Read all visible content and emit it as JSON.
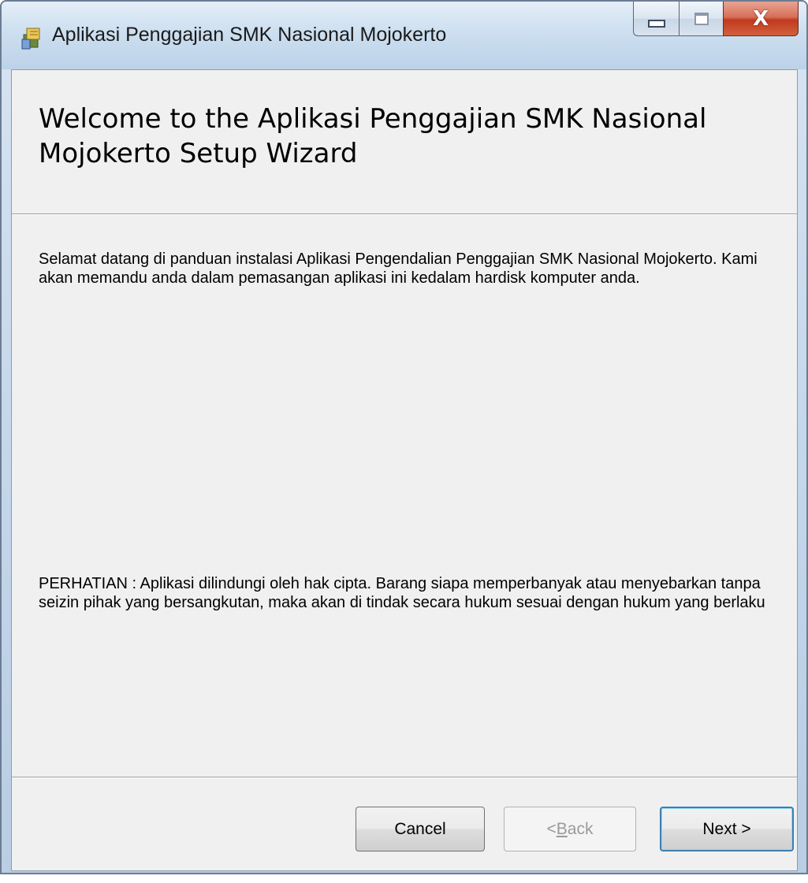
{
  "window": {
    "title": "Aplikasi Penggajian SMK Nasional Mojokerto",
    "icon": "installer-package-icon"
  },
  "caption_buttons": {
    "minimize_icon": "minimize-icon",
    "maximize_icon": "maximize-icon",
    "close_label": "X"
  },
  "header": {
    "title": "Welcome to the Aplikasi Penggajian SMK Nasional Mojokerto Setup Wizard"
  },
  "body": {
    "intro": "Selamat datang di panduan instalasi Aplikasi Pengendalian Penggajian SMK Nasional Mojokerto. Kami akan memandu anda dalam pemasangan aplikasi ini kedalam hardisk komputer anda.",
    "notice": "PERHATIAN : Aplikasi dilindungi oleh hak cipta. Barang siapa memperbanyak atau menyebarkan tanpa seizin pihak yang bersangkutan, maka akan di tindak secara hukum sesuai dengan hukum yang berlaku"
  },
  "buttons": {
    "cancel": "Cancel",
    "back_prefix": "< ",
    "back_accel": "B",
    "back_rest": "ack",
    "next": "Next >"
  },
  "colors": {
    "dialog_bg": "#f0f0f0",
    "titlebar": "#cddff0",
    "close_button": "#c03a1e",
    "default_button_border": "#3c7fb1"
  }
}
